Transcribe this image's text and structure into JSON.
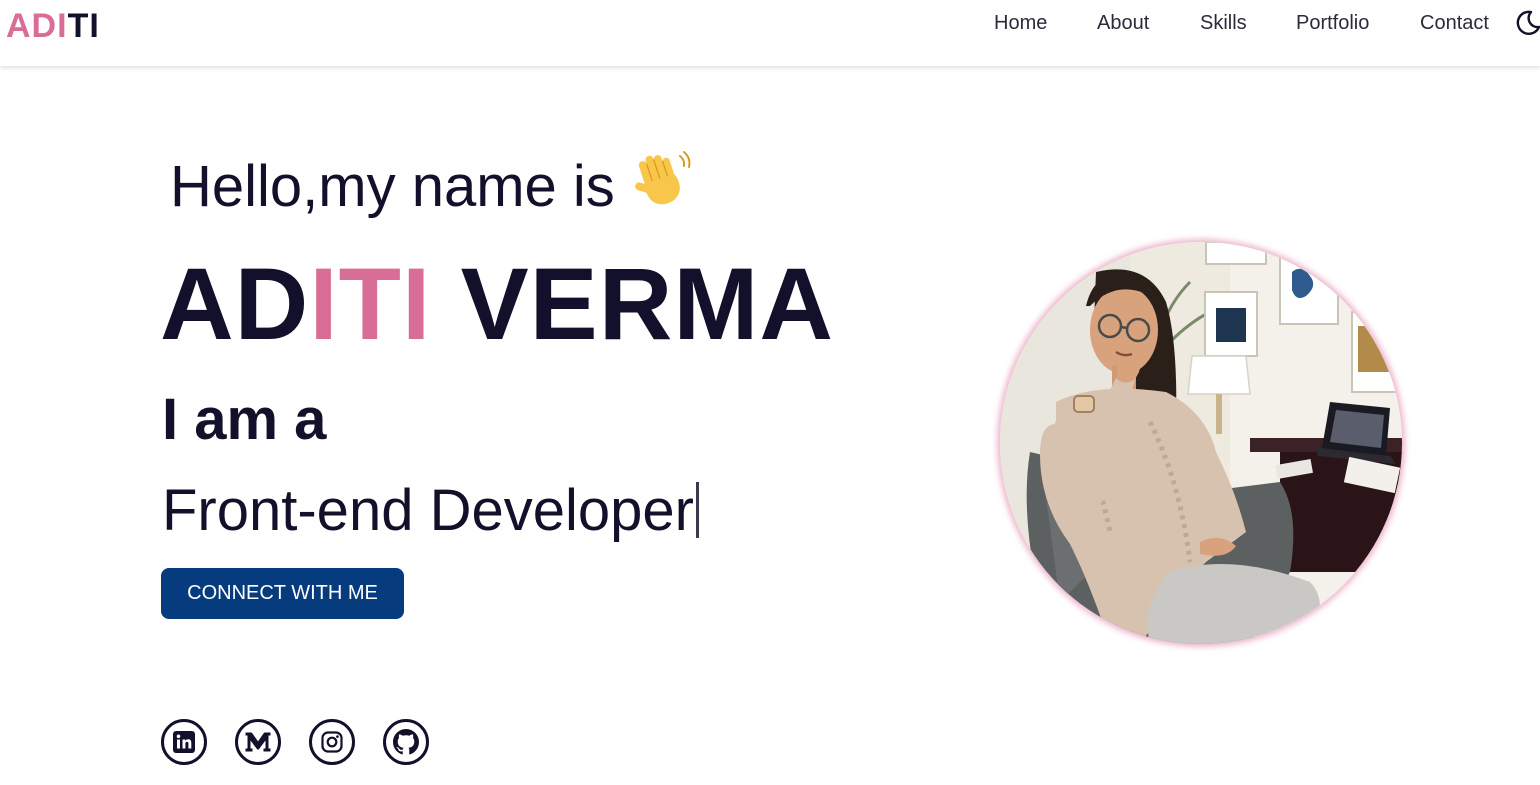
{
  "navbar": {
    "logo_part1": "ADI",
    "logo_part2": "TI",
    "links": [
      "Home",
      "About",
      "Skills",
      "Portfolio",
      "Contact"
    ],
    "theme_icon": "moon-icon"
  },
  "hero": {
    "greeting": "Hello,my name is",
    "greeting_icon": "waving-hand-icon",
    "name_part1": "AD",
    "name_part2": "ITI",
    "name_part3": " VERMA",
    "intro": "I am a",
    "role": "Front-end Developer",
    "cta_label": "CONNECT WITH ME"
  },
  "socials": [
    {
      "icon": "linkedin-icon"
    },
    {
      "icon": "medium-icon"
    },
    {
      "icon": "instagram-icon"
    },
    {
      "icon": "github-icon"
    }
  ],
  "portrait": {
    "icon": "profile-photo"
  },
  "colors": {
    "accent_pink": "#d86e96",
    "text_dark": "#12102a",
    "button_blue": "#063b7e"
  }
}
